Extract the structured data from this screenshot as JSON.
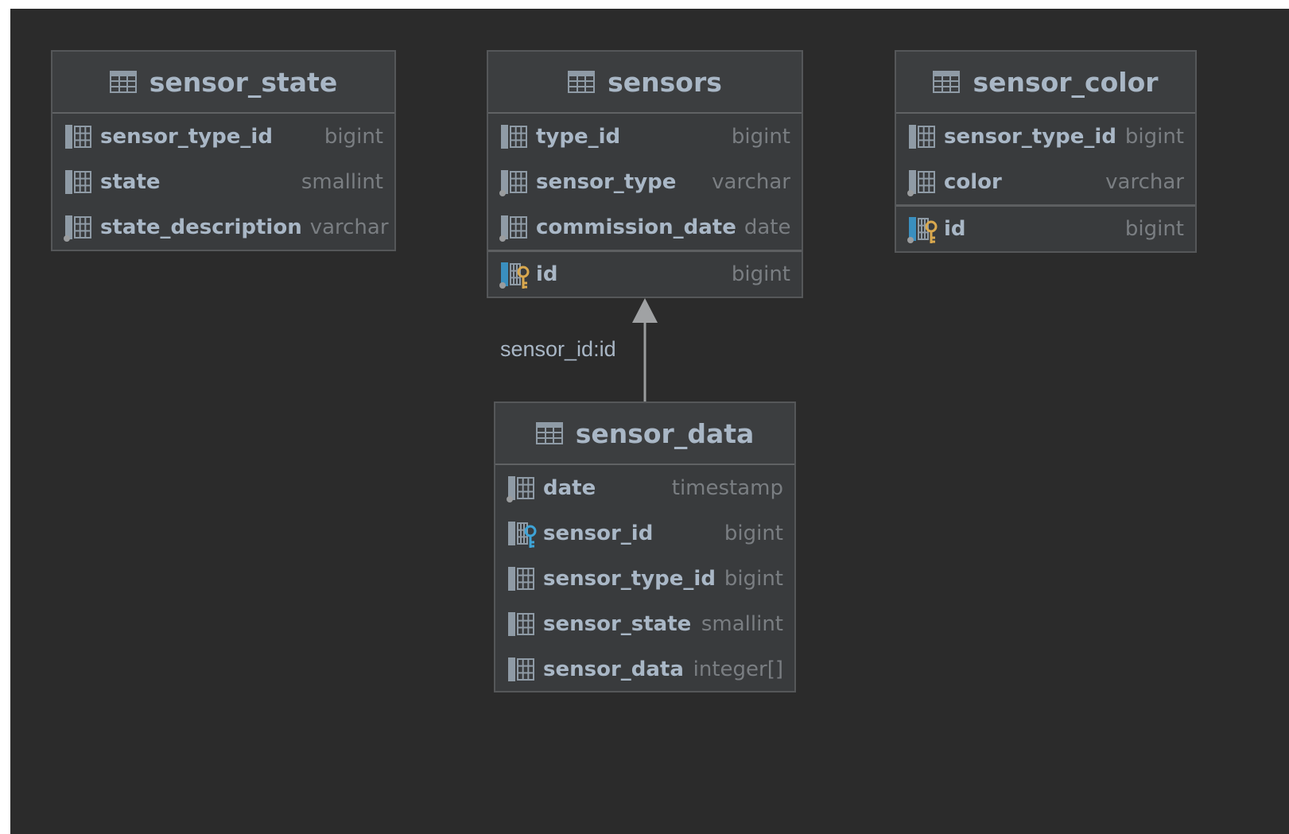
{
  "colors": {
    "background": "#2b2b2b",
    "table_body": "#393b3d",
    "text": "#a9b7c6",
    "type_text": "#7a7e82",
    "primary_key": "#d9a84e",
    "foreign_key": "#3ea3d6"
  },
  "tables": {
    "sensor_state": {
      "name": "sensor_state",
      "icon": "table-icon",
      "columns": [
        {
          "name": "sensor_type_id",
          "type": "bigint",
          "icon": "column-icon"
        },
        {
          "name": "state",
          "type": "smallint",
          "icon": "column-icon"
        },
        {
          "name": "state_description",
          "type": "varchar",
          "icon": "nullable-column-icon"
        }
      ]
    },
    "sensors": {
      "name": "sensors",
      "icon": "table-icon",
      "columns": [
        {
          "name": "type_id",
          "type": "bigint",
          "icon": "column-icon"
        },
        {
          "name": "sensor_type",
          "type": "varchar",
          "icon": "nullable-column-icon"
        },
        {
          "name": "commission_date",
          "type": "date",
          "icon": "nullable-column-icon"
        },
        {
          "name": "id",
          "type": "bigint",
          "icon": "primary-key-icon"
        }
      ]
    },
    "sensor_color": {
      "name": "sensor_color",
      "icon": "table-icon",
      "columns": [
        {
          "name": "sensor_type_id",
          "type": "bigint",
          "icon": "column-icon"
        },
        {
          "name": "color",
          "type": "varchar",
          "icon": "nullable-column-icon"
        },
        {
          "name": "id",
          "type": "bigint",
          "icon": "primary-key-icon"
        }
      ]
    },
    "sensor_data": {
      "name": "sensor_data",
      "icon": "table-icon",
      "columns": [
        {
          "name": "date",
          "type": "timestamp",
          "icon": "nullable-column-icon"
        },
        {
          "name": "sensor_id",
          "type": "bigint",
          "icon": "foreign-key-icon"
        },
        {
          "name": "sensor_type_id",
          "type": "bigint",
          "icon": "column-icon"
        },
        {
          "name": "sensor_state",
          "type": "smallint",
          "icon": "column-icon"
        },
        {
          "name": "sensor_data",
          "type": "integer[]",
          "icon": "column-icon"
        }
      ]
    }
  },
  "relation": {
    "label": "sensor_id:id",
    "from": "sensor_data",
    "to": "sensors"
  }
}
